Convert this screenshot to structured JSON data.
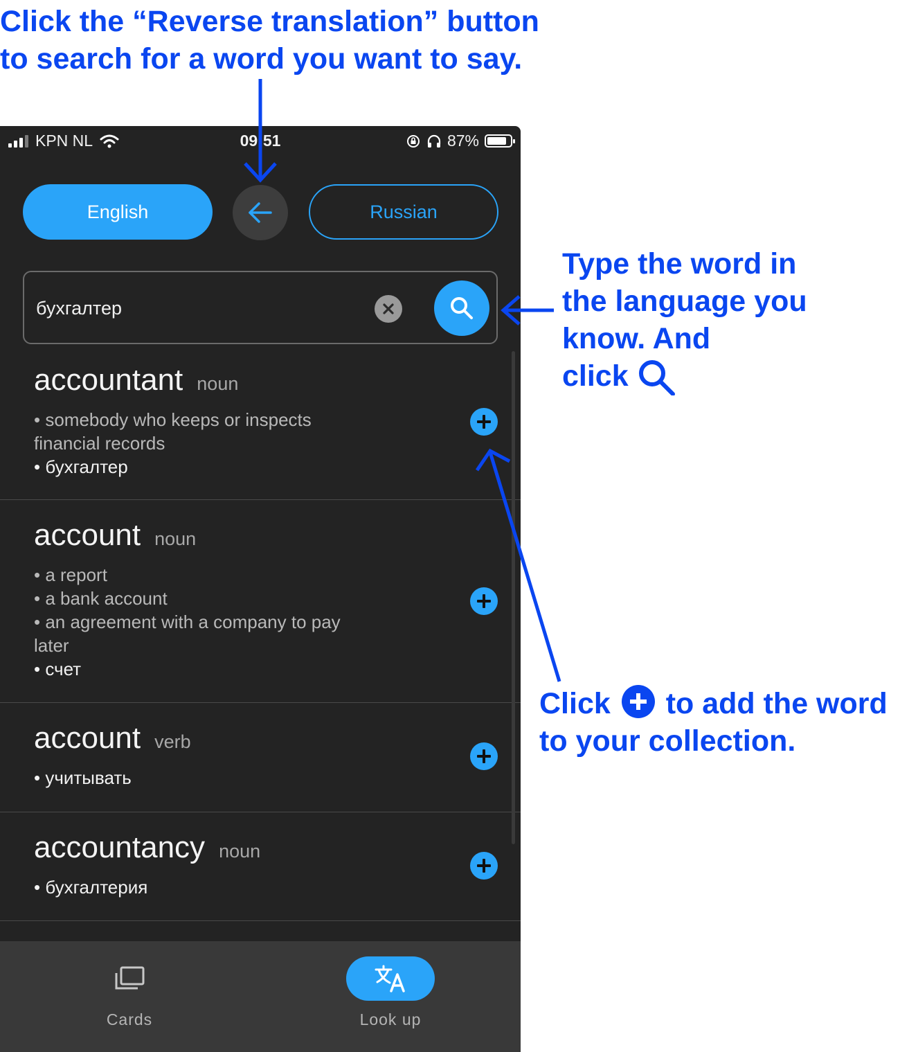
{
  "annotations": {
    "top": [
      "Click the “Reverse translation” button",
      "to search for a word you want to say."
    ],
    "right": [
      "Type the word in",
      "the language you",
      "know. And",
      "click"
    ],
    "bottom_pre": "Click",
    "bottom_post": "to add the word",
    "bottom_line2": "to your collection."
  },
  "status_bar": {
    "carrier": "KPN NL",
    "time": "09:51",
    "battery": "87%",
    "icons": [
      "signal-icon",
      "wifi-icon",
      "orientation-lock-icon",
      "headphones-icon",
      "battery-icon"
    ]
  },
  "languages": {
    "source": "English",
    "target": "Russian",
    "swap_icon": "arrow-left-icon"
  },
  "search": {
    "value": "бухгалтер",
    "clear_icon": "clear-icon",
    "search_icon": "search-icon"
  },
  "results": [
    {
      "word": "accountant",
      "pos": "noun",
      "definitions": [
        "• somebody who keeps or inspects",
        "financial records"
      ],
      "translation": "• бухгалтер"
    },
    {
      "word": "account",
      "pos": "noun",
      "definitions": [
        "• a report",
        "• a bank account",
        "• an agreement with a company to pay",
        "later"
      ],
      "translation": "• счет"
    },
    {
      "word": "account",
      "pos": "verb",
      "definitions": [],
      "translation": "• учитывать"
    },
    {
      "word": "accountancy",
      "pos": "noun",
      "definitions": [],
      "translation": "• бухгалтерия"
    }
  ],
  "tabs": [
    {
      "label": "Cards",
      "icon": "cards-icon",
      "active": false
    },
    {
      "label": "Look up",
      "icon": "translate-icon",
      "active": true
    }
  ],
  "colors": {
    "accent": "#2aa4f9",
    "annotation": "#0a46f0",
    "background": "#232323",
    "tab_bar": "#393939"
  }
}
